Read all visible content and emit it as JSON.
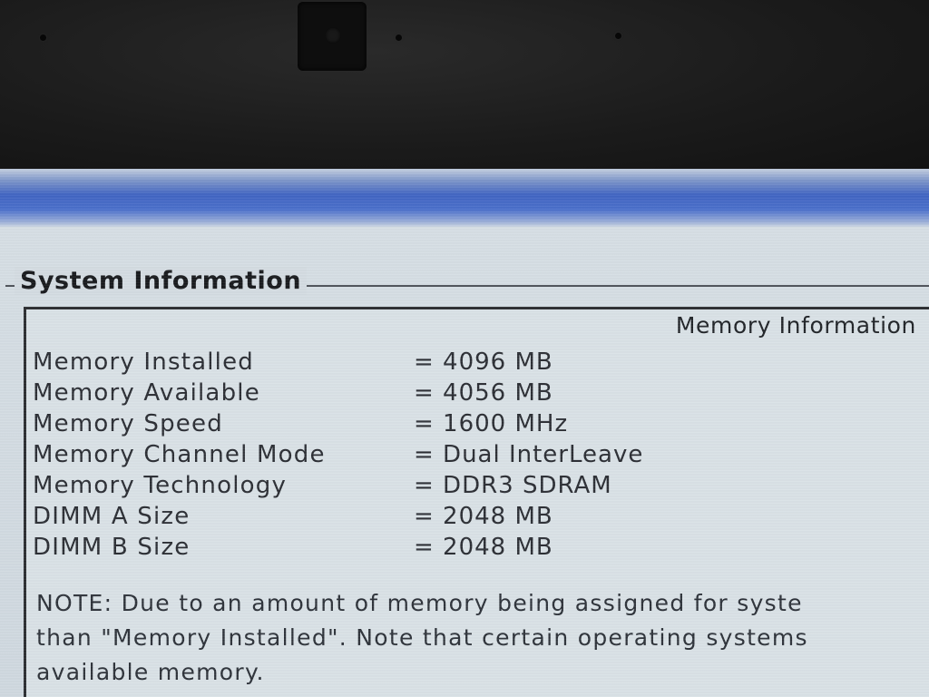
{
  "window": {
    "group_title": "System Information",
    "section_header": "Memory Information"
  },
  "memory": {
    "rows": [
      {
        "label": "Memory Installed",
        "value": "= 4096 MB"
      },
      {
        "label": "Memory Available",
        "value": "= 4056 MB"
      },
      {
        "label": "Memory Speed",
        "value": "= 1600 MHz"
      },
      {
        "label": "Memory Channel Mode",
        "value": "= Dual InterLeave"
      },
      {
        "label": "Memory Technology",
        "value": "= DDR3 SDRAM"
      },
      {
        "label": "DIMM A Size",
        "value": "= 2048 MB"
      },
      {
        "label": "DIMM B Size",
        "value": "= 2048 MB"
      }
    ]
  },
  "note": {
    "lines": [
      "NOTE: Due to an amount of memory being assigned for syste",
      "than \"Memory Installed\". Note that certain operating systems",
      "available memory."
    ]
  },
  "colors": {
    "title_band": "#3f63c2",
    "panel_bg": "#d4dde3",
    "text": "#2a2d33"
  }
}
